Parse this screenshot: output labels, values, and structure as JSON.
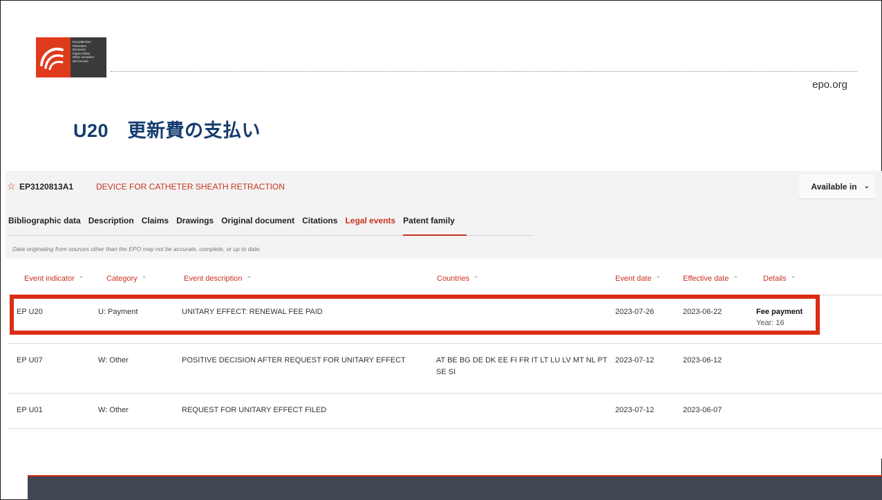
{
  "header": {
    "logo_lines": [
      "Europäisches",
      "Patentamt",
      "European",
      "Patent Office",
      "Office européen",
      "des brevets"
    ],
    "site_link": "epo.org",
    "slide_title": "U20　更新費の支払い"
  },
  "publication": {
    "number": "EP3120813A1",
    "title": "DEVICE FOR CATHETER SHEATH RETRACTION",
    "available_in": "Available in"
  },
  "tabs": [
    {
      "label": "Bibliographic data"
    },
    {
      "label": "Description"
    },
    {
      "label": "Claims"
    },
    {
      "label": "Drawings"
    },
    {
      "label": "Original document"
    },
    {
      "label": "Citations"
    },
    {
      "label": "Legal events",
      "active": true
    },
    {
      "label": "Patent family"
    }
  ],
  "disclaimer": "Data originating from sources other than the EPO may not be accurate, complete, or up to date.",
  "table": {
    "columns": [
      "Event indicator",
      "Category",
      "Event description",
      "Countries",
      "Event date",
      "Effective date",
      "Details"
    ],
    "rows": [
      {
        "indicator": "EP U20",
        "category": "U: Payment",
        "description": "UNITARY EFFECT: RENEWAL FEE PAID",
        "countries": "",
        "event_date": "2023-07-26",
        "effective_date": "2023-06-22",
        "details_title": "Fee payment",
        "details_sub": "Year: 16"
      },
      {
        "indicator": "EP U07",
        "category": "W: Other",
        "description": "POSITIVE DECISION AFTER REQUEST FOR UNITARY EFFECT",
        "countries": "AT BE BG DE DK EE FI FR IT LT LU LV MT NL PT SE SI",
        "event_date": "2023-07-12",
        "effective_date": "2023-06-12",
        "details_title": "",
        "details_sub": ""
      },
      {
        "indicator": "EP U01",
        "category": "W: Other",
        "description": "REQUEST FOR UNITARY EFFECT FILED",
        "countries": "",
        "event_date": "2023-07-12",
        "effective_date": "2023-06-07",
        "details_title": "",
        "details_sub": ""
      }
    ]
  },
  "colors": {
    "accent_red": "#d92d14",
    "title_navy": "#153c6e",
    "footer": "#404652"
  }
}
